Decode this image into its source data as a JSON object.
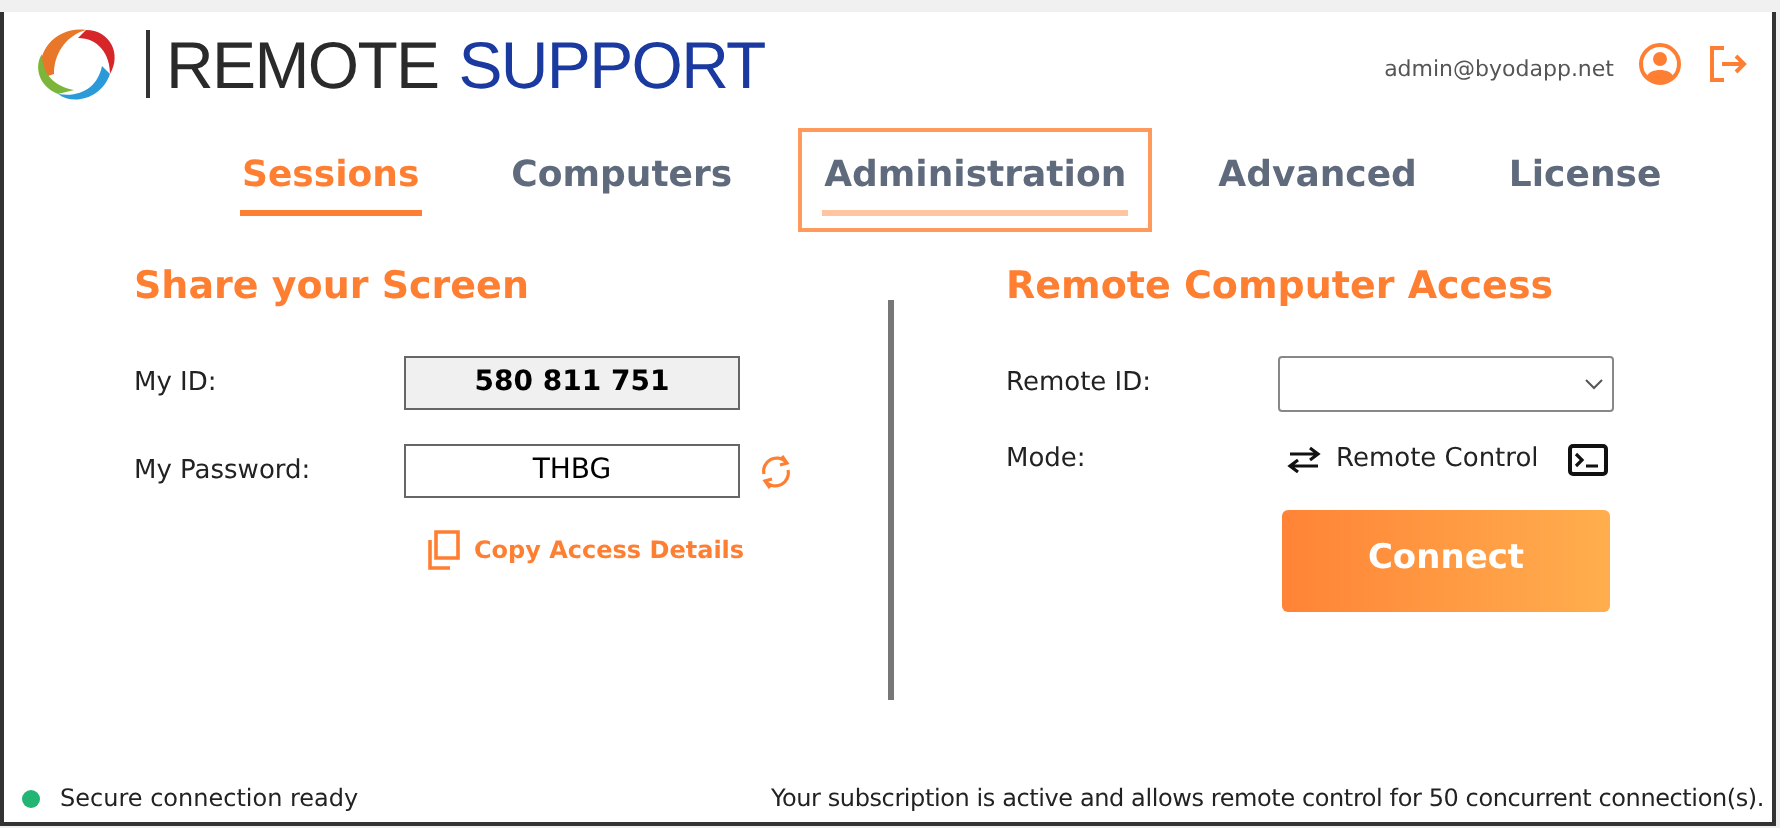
{
  "logo": {
    "word_1": "REMOTE",
    "word_2": "SUPPORT"
  },
  "user": {
    "email": "admin@byodapp.net"
  },
  "tabs": [
    {
      "label": "Sessions",
      "selected": true,
      "focused": false
    },
    {
      "label": "Computers",
      "selected": false,
      "focused": false
    },
    {
      "label": "Administration",
      "selected": false,
      "focused": true
    },
    {
      "label": "Advanced",
      "selected": false,
      "focused": false
    },
    {
      "label": "License",
      "selected": false,
      "focused": false
    }
  ],
  "share": {
    "title": "Share your Screen",
    "id_label": "My ID:",
    "id_value": "580 811 751",
    "password_label": "My Password:",
    "password_value": "THBG",
    "copy_link": "Copy Access Details"
  },
  "remote": {
    "title": "Remote Computer Access",
    "remote_id_label": "Remote ID:",
    "mode_label": "Mode:",
    "mode_value": "Remote Control",
    "connect_button": "Connect"
  },
  "status_bar": {
    "connection": {
      "text": "Secure connection ready",
      "color": "#22b573"
    },
    "subscription": "Your subscription is active and allows remote control for 50 concurrent connection(s)."
  }
}
